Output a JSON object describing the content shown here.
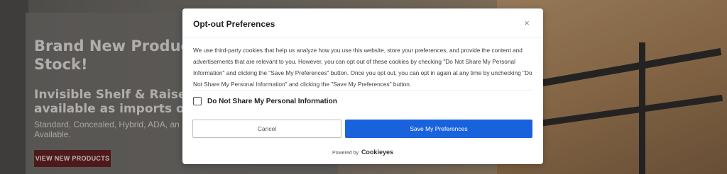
{
  "hero": {
    "title": "Brand New Produc… Stock!",
    "title_line1": "Brand New Produc",
    "title_line2": "Stock!",
    "subtitle_line1": "Invisible Shelf & Raised",
    "subtitle_line2": "available as imports or n",
    "small_line1": "Standard, Concealed, Hybrid, ADA, an",
    "small_line2": "Available.",
    "cta_label": "VIEW NEW PRODUCTS"
  },
  "modal": {
    "title": "Opt-out Preferences",
    "close_label": "×",
    "body": "We use third-party cookies that help us analyze how you use this website, store your preferences, and provide the content and advertisements that are relevant to you. However, you can opt out of these cookies by checking \"Do Not Share My Personal Information\" and clicking the \"Save My Preferences\" button. Once you opt out, you can opt in again at any time by unchecking \"Do Not Share My Personal Information\" and clicking the \"Save My Preferences\" button.",
    "checkbox_label": "Do Not Share My Personal Information",
    "checkbox_checked": false,
    "cancel_label": "Cancel",
    "save_label": "Save My Preferences",
    "powered_by": "Powered by",
    "powered_brand": "Cookieyes"
  },
  "colors": {
    "primary_button": "#1863dc",
    "cta_button": "#5e1f20"
  }
}
